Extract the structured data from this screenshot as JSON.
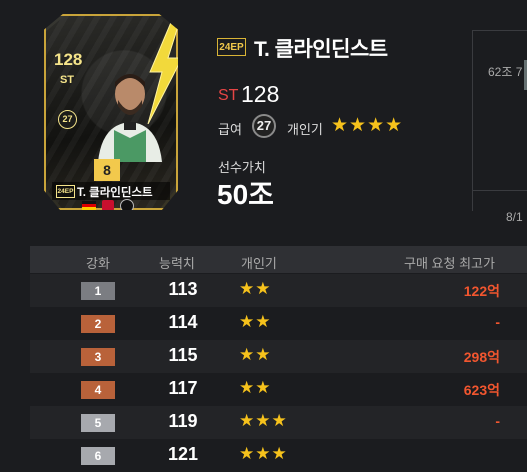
{
  "card": {
    "ovr": "128",
    "position": "ST",
    "season_number": "27",
    "level": "8",
    "season_tag": "24EP",
    "name": "T. 클라인딘스트"
  },
  "info": {
    "season_tag": "24EP",
    "name": "T. 클라인딘스트",
    "position": "ST",
    "ovr": "128",
    "pay_label": "급여",
    "pay": "27",
    "popularity_label": "개인기",
    "popularity_stars": "★★★★",
    "value_label": "선수가치",
    "value": "50조"
  },
  "graph": {
    "top_label": "62조 7",
    "date_label": "8/1"
  },
  "table": {
    "headers": {
      "level": "강화",
      "ovr": "능력치",
      "popularity": "개인기",
      "price": "구매 요청 최고가"
    },
    "rows": [
      {
        "level": "1",
        "ovr": "113",
        "stars": "★★",
        "price": "122억",
        "color": "#7b7d82"
      },
      {
        "level": "2",
        "ovr": "114",
        "stars": "★★",
        "price": "-",
        "color": "#b9623a"
      },
      {
        "level": "3",
        "ovr": "115",
        "stars": "★★",
        "price": "298억",
        "color": "#b9623a"
      },
      {
        "level": "4",
        "ovr": "117",
        "stars": "★★",
        "price": "623억",
        "color": "#b9623a"
      },
      {
        "level": "5",
        "ovr": "119",
        "stars": "★★★",
        "price": "-",
        "color": "#a7a9ae"
      },
      {
        "level": "6",
        "ovr": "121",
        "stars": "★★★",
        "price": "",
        "color": "#a7a9ae"
      }
    ]
  },
  "colors": {
    "accent_gold": "#f1c84b",
    "star": "#f6c21c",
    "price_red": "#f2562f",
    "position_red": "#e64545"
  }
}
